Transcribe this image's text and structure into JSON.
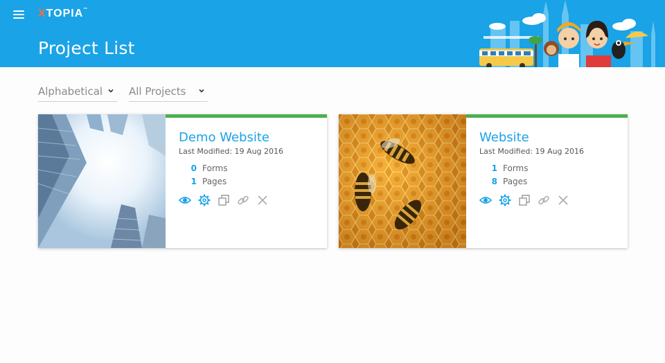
{
  "header": {
    "logo_x": "X",
    "logo_rest": "TOPIA",
    "logo_tm": "™",
    "title": "Project List"
  },
  "filters": {
    "sort": "Alphabetical",
    "scope": "All Projects"
  },
  "projects": [
    {
      "name": "Demo Website",
      "modified": "Last Modified: 19 Aug 2016",
      "forms_count": "0",
      "forms_label": "Forms",
      "pages_count": "1",
      "pages_label": "Pages",
      "thumbnail": "skyscrapers-image"
    },
    {
      "name": "Website",
      "modified": "Last Modified: 19 Aug 2016",
      "forms_count": "1",
      "forms_label": "Forms",
      "pages_count": "8",
      "pages_label": "Pages",
      "thumbnail": "honeycomb-bees-image"
    }
  ],
  "colors": {
    "header_bg": "#1aa3e6",
    "accent": "#1aa3e6",
    "status_bar": "#4caf50",
    "logo_x": "#ff6a3d"
  },
  "icons": [
    "menu-icon",
    "eye-icon",
    "gear-icon",
    "duplicate-icon",
    "link-icon",
    "close-icon",
    "chevron-down-icon"
  ]
}
